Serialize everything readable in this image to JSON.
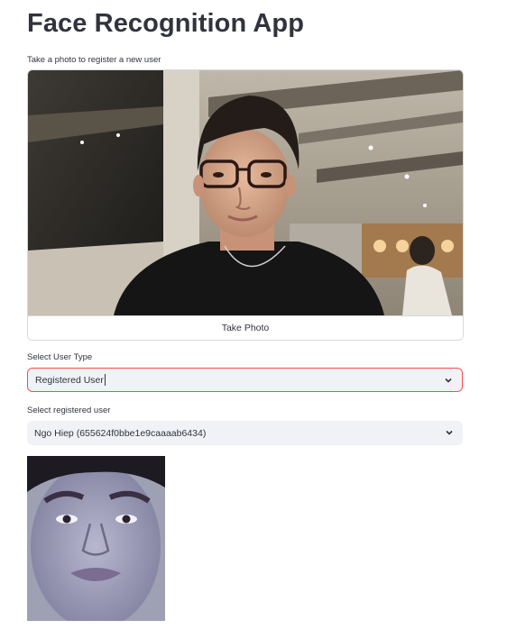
{
  "app": {
    "title": "Face Recognition App"
  },
  "camera": {
    "label": "Take a photo to register a new user",
    "take_photo_label": "Take Photo"
  },
  "user_type": {
    "label": "Select User Type",
    "value": "Registered User"
  },
  "registered_user": {
    "label": "Select registered user",
    "value": "Ngo Hiep (655624f0bbe1e9caaaab6434)"
  },
  "colors": {
    "focus_border": "#ff4b4b",
    "select_bg": "#f0f2f6",
    "text": "#31333f"
  },
  "icons": {
    "dropdown": "chevron-down-icon"
  }
}
